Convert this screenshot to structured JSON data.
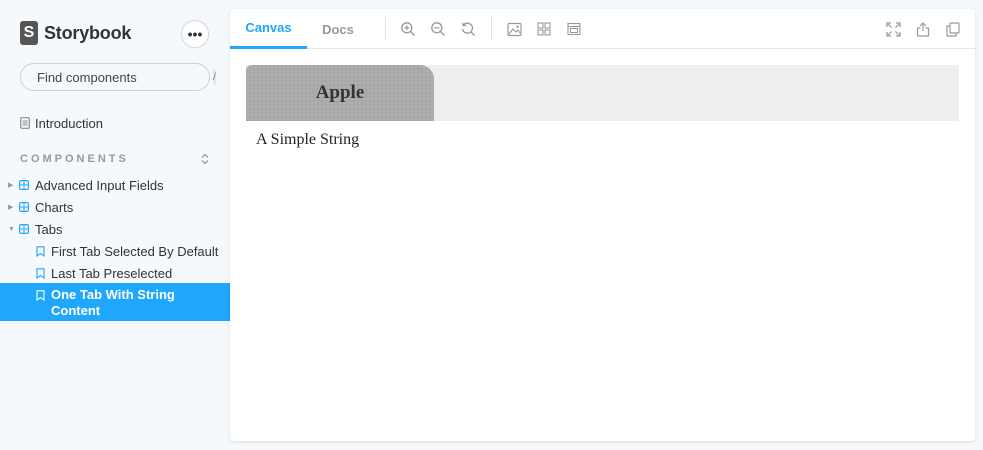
{
  "brand": {
    "name": "Storybook",
    "logo_glyph": "S"
  },
  "menu": {
    "label": "•••"
  },
  "search": {
    "placeholder": "Find components",
    "shortcut": "/"
  },
  "nav": {
    "introduction": "Introduction"
  },
  "components": {
    "section_title": "COMPONENTS",
    "items": [
      {
        "label": "Advanced Input Fields",
        "expanded": false
      },
      {
        "label": "Charts",
        "expanded": false
      },
      {
        "label": "Tabs",
        "expanded": true
      }
    ],
    "stories": [
      {
        "label": "First Tab Selected By Default",
        "active": false
      },
      {
        "label": "Last Tab Preselected",
        "active": false
      },
      {
        "label": "One Tab With String Content",
        "active": true
      }
    ]
  },
  "toolbar": {
    "tabs": [
      {
        "label": "Canvas",
        "active": true
      },
      {
        "label": "Docs",
        "active": false
      }
    ],
    "tools": [
      "zoom-in-icon",
      "zoom-out-icon",
      "zoom-reset-icon",
      "background-icon",
      "grid-icon",
      "outline-icon"
    ],
    "right_tools": [
      "fullscreen-icon",
      "share-icon",
      "copy-link-icon"
    ]
  },
  "preview": {
    "tab_label": "Apple",
    "content": "A Simple String"
  },
  "colors": {
    "accent": "#1ea7fd",
    "sidebar_bg": "#f6f9fc",
    "tab_bg": "#a8a8a8",
    "strip_bg": "#eeeeee"
  }
}
